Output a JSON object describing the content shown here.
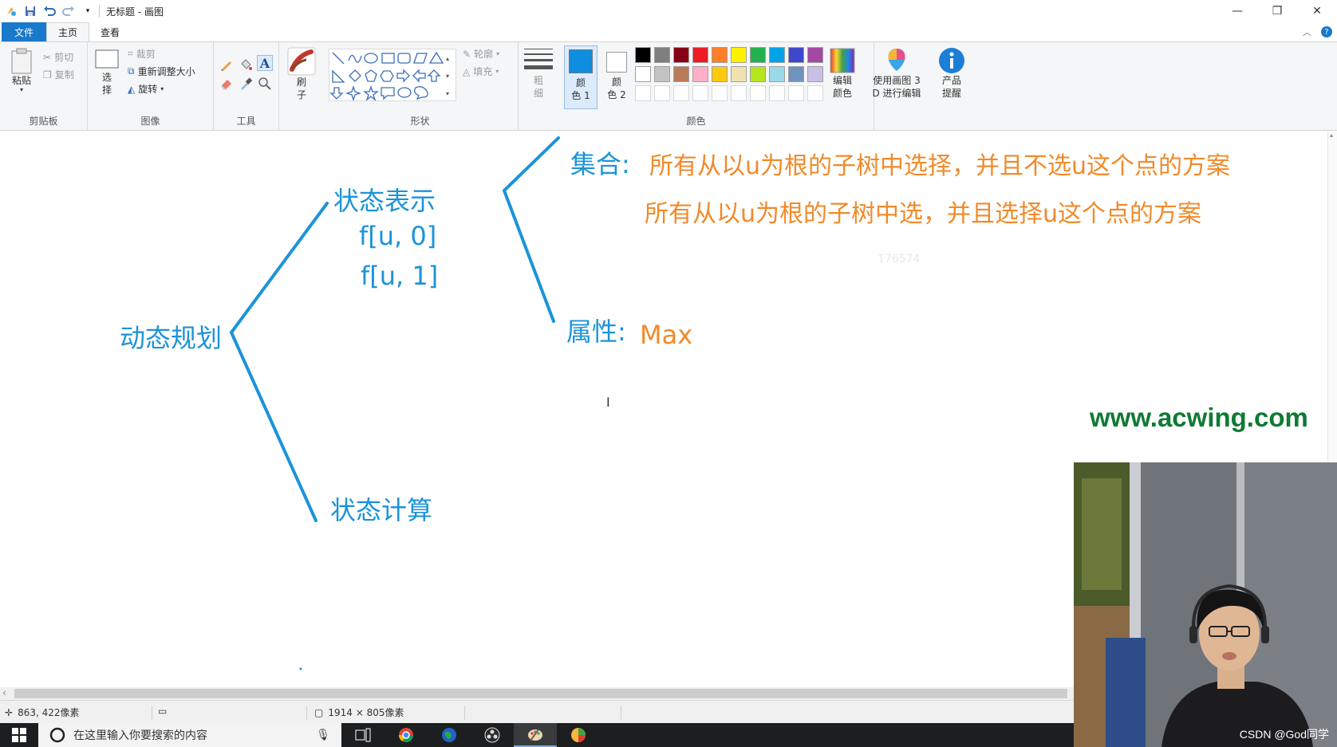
{
  "window": {
    "title": "无标题 - 画图",
    "controls": {
      "minimize": "—",
      "maximize": "❐",
      "close": "✕"
    }
  },
  "tabs": {
    "file": "文件",
    "home": "主页",
    "view": "查看"
  },
  "ribbon": {
    "clipboard": {
      "paste": "粘贴",
      "cut": "剪切",
      "copy": "复制",
      "label": "剪贴板"
    },
    "image": {
      "select_top": "选",
      "select_bottom": "择",
      "crop": "裁剪",
      "resize": "重新调整大小",
      "rotate": "旋转",
      "label": "图像"
    },
    "tools": {
      "text_tool": "A",
      "label": "工具"
    },
    "brushes": {
      "top": "刷",
      "bottom": "子"
    },
    "shapes": {
      "outline": "轮廓",
      "fill": "填充",
      "label": "形状"
    },
    "size": {
      "top": "粗",
      "bottom": "细"
    },
    "color1": {
      "top": "颜",
      "bottom": "色 1",
      "value": "#0f8ee0"
    },
    "color2": {
      "top": "颜",
      "bottom": "色 2",
      "value": "#ffffff"
    },
    "colors_label": "颜色",
    "edit_colors": {
      "top": "编辑",
      "bottom": "颜色"
    },
    "paint3d": {
      "top": "使用画图 3",
      "bottom": "D 进行编辑"
    },
    "product_alert": {
      "top": "产品",
      "bottom": "提醒"
    },
    "palette_row1": [
      "#000000",
      "#7f7f7f",
      "#880015",
      "#ed1c24",
      "#ff7f27",
      "#fff200",
      "#22b14c",
      "#00a2e8",
      "#3f48cc",
      "#a349a4"
    ],
    "palette_row2": [
      "#ffffff",
      "#c3c3c3",
      "#b97a57",
      "#ffaec9",
      "#ffc90e",
      "#efe4b0",
      "#b5e61d",
      "#99d9ea",
      "#7092be",
      "#c8bfe7"
    ]
  },
  "canvas": {
    "root": "动态规划",
    "state_repr": "状态表示",
    "f0": "f[u, 0]",
    "f1": "f[u, 1]",
    "state_calc": "状态计算",
    "set_label": "集合:",
    "set_line1": "所有从以u为根的子树中选择，并且不选u这个点的方案",
    "set_line2": "所有从以u为根的子树中选，并且选择u这个点的方案",
    "attr_label": "属性:",
    "attr_value": "Max",
    "faint_number": "176574",
    "website": "www.acwing.com",
    "line_color": "#1c93d8"
  },
  "statusbar": {
    "cursor_pos": "863, 422像素",
    "canvas_size": "1914 × 805像素"
  },
  "taskbar": {
    "search_placeholder": "在这里输入你要搜索的内容"
  },
  "watermark": "CSDN @God同学"
}
